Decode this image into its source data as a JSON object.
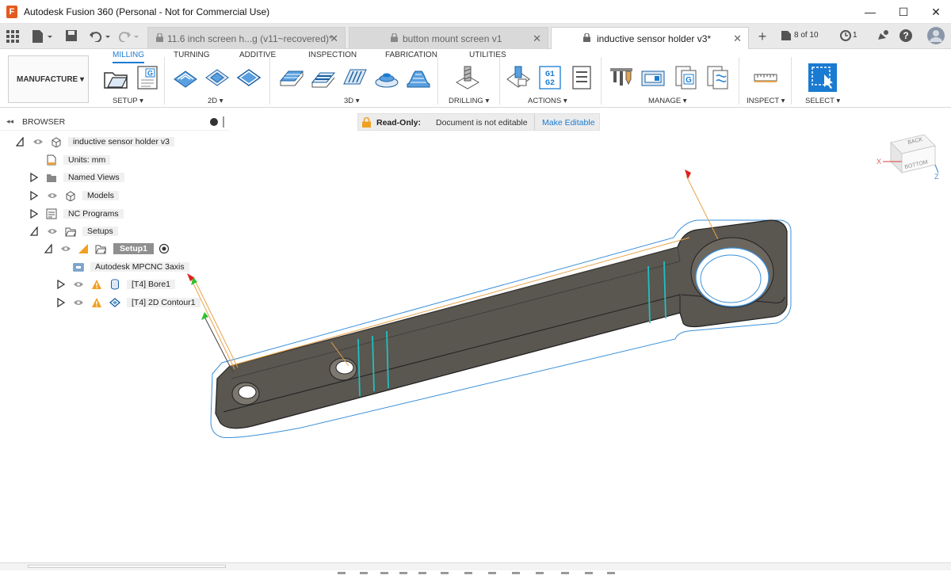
{
  "window": {
    "app_icon_letter": "F",
    "title": "Autodesk Fusion 360 (Personal - Not for Commercial Use)",
    "minimize": "—",
    "maximize": "☐",
    "close": "✕"
  },
  "tabs": [
    {
      "label": "11.6 inch screen h...g (v11~recovered)*",
      "close": "✕"
    },
    {
      "label": "button mount screen v1",
      "close": "✕"
    },
    {
      "label": "inductive sensor holder v3*",
      "close": "✕"
    }
  ],
  "tabstrip": {
    "new_tab": "+",
    "doc_count": "8 of 10",
    "jobs_count": "1"
  },
  "ribbon": {
    "tabs": [
      "MILLING",
      "TURNING",
      "ADDITIVE",
      "INSPECTION",
      "FABRICATION",
      "UTILITIES"
    ],
    "workspace": "MANUFACTURE ▾",
    "groups": {
      "setup": "SETUP ▾",
      "two_d": "2D ▾",
      "three_d": "3D ▾",
      "drilling": "DRILLING ▾",
      "actions": "ACTIONS ▾",
      "manage": "MANAGE ▾",
      "inspect": "INSPECT ▾",
      "select": "SELECT ▾"
    },
    "gcode_glyph": "G",
    "g1g2_glyph_1": "G1",
    "g1g2_glyph_2": "G2"
  },
  "browser": {
    "header_arrow": "◂◂",
    "title": "BROWSER",
    "items": {
      "root": "inductive sensor holder v3",
      "units": "Units: mm",
      "named_views": "Named Views",
      "models": "Models",
      "nc_programs": "NC Programs",
      "setups": "Setups",
      "setup1": "Setup1",
      "machine": "Autodesk MPCNC 3axis",
      "bore": "[T4] Bore1",
      "contour": "[T4] 2D Contour1"
    }
  },
  "readonly": {
    "label": "Read-Only:",
    "message": "Document is not editable",
    "action": "Make Editable"
  },
  "viewcube": {
    "back": "BACK",
    "bottom": "BOTTOM",
    "x_axis": "X",
    "z_axis": "Z"
  },
  "colors": {
    "accent": "#1a7bd2",
    "part_body": "#5a5650",
    "toolpath": "#e8a34a",
    "outline": "#3a8fd8",
    "warning": "#f0a020"
  }
}
